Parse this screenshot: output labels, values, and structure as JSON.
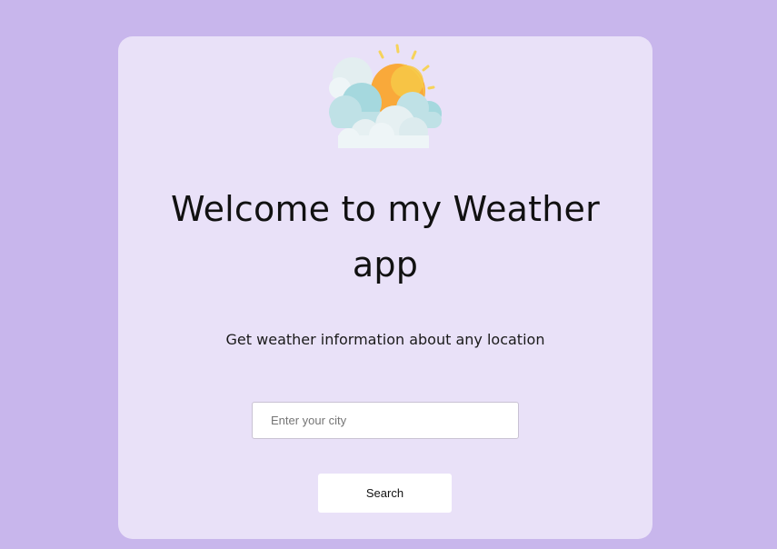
{
  "logo": {
    "icon": "partly-cloudy-sun-icon",
    "colors": {
      "sun": "#f9b233",
      "sun_highlight": "#f7cf4c",
      "rays": "#f6d35a",
      "cloud_teal": "#9fd5dc",
      "cloud_light": "#d7ecef",
      "cloud_white": "#eef5f7"
    }
  },
  "header": {
    "title": "Welcome to my Weather app",
    "subtitle": "Get weather information about any location"
  },
  "search": {
    "placeholder": "Enter your city",
    "value": "",
    "button_label": "Search"
  },
  "colors": {
    "page_background": "#c8b6ec",
    "card_background": "#e9e1f8"
  }
}
